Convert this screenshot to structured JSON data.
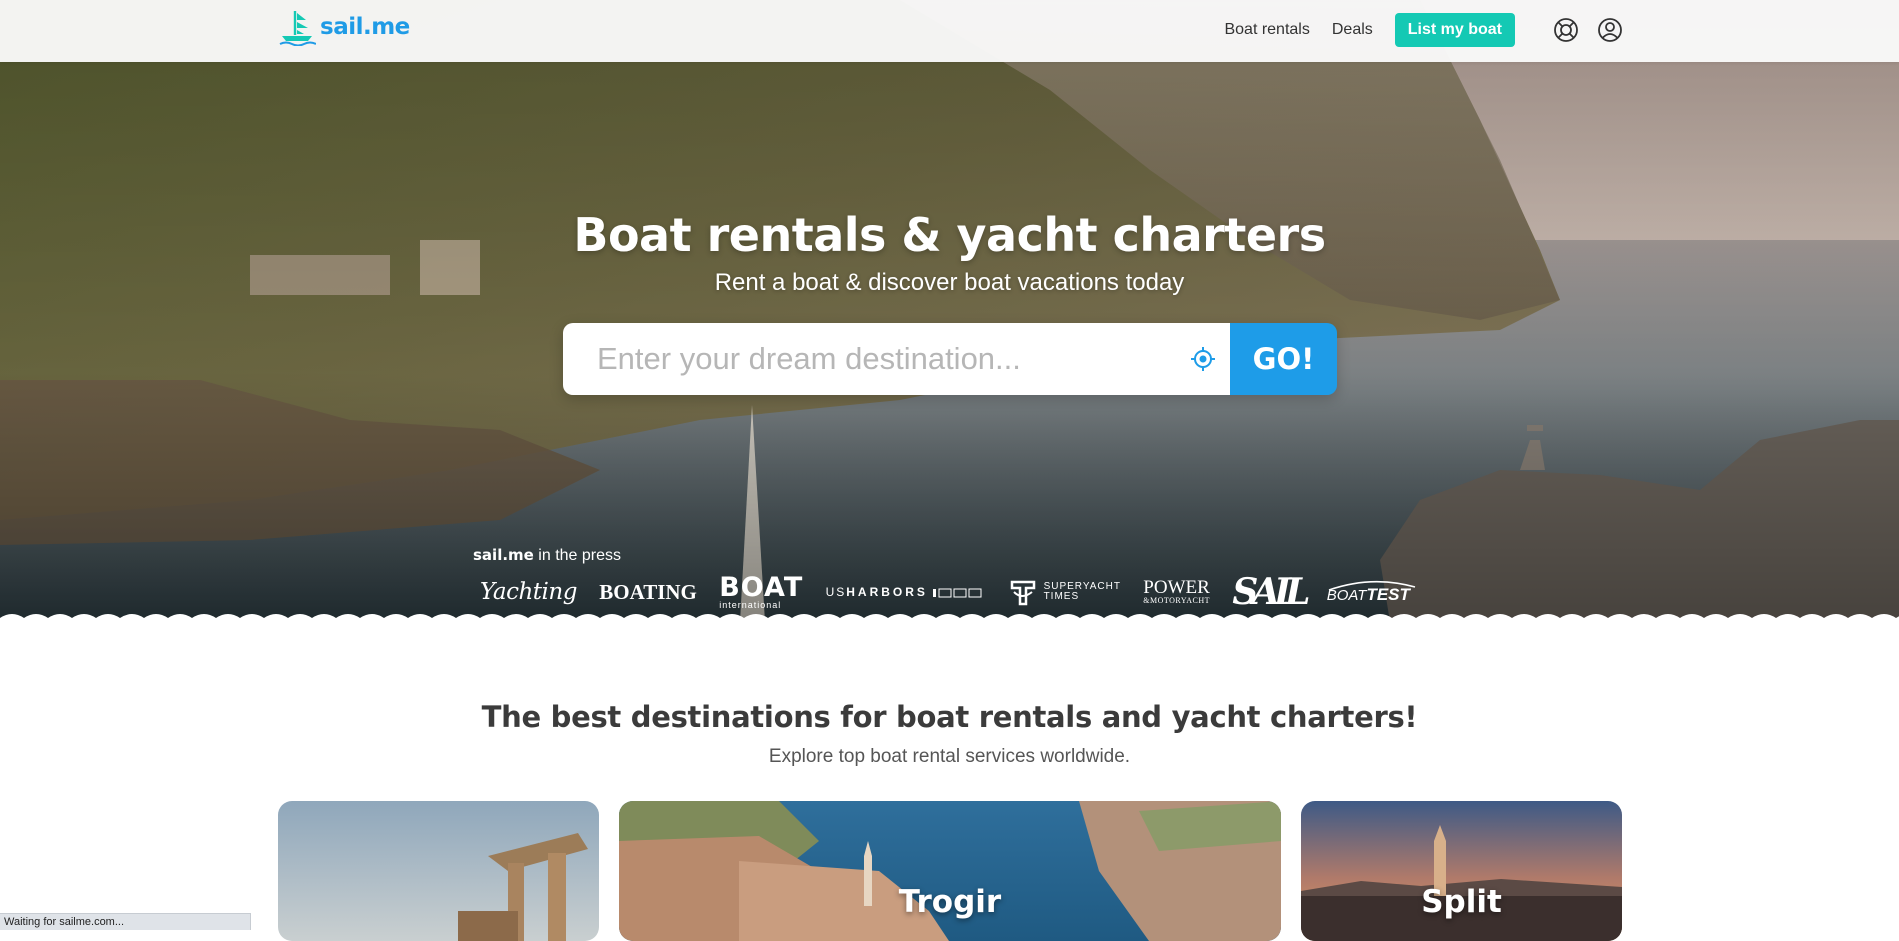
{
  "header": {
    "logo_text": "sail.me",
    "nav": {
      "boat_rentals": "Boat rentals",
      "deals": "Deals",
      "list_my_boat": "List my boat"
    },
    "icons": [
      "lifebuoy-icon",
      "user-icon"
    ]
  },
  "hero": {
    "title": "Boat rentals & yacht charters",
    "subtitle": "Rent a boat & discover boat vacations today",
    "search": {
      "placeholder": "Enter your dream destination...",
      "value": "",
      "button": "GO!"
    },
    "press": {
      "brand": "sail.me",
      "label": " in the press",
      "logos": {
        "yachting": "Yachting",
        "boating": "BOATING",
        "boat_big": "BOAT",
        "boat_small": "international",
        "usharbors_us": "US",
        "usharbors_name": "HARBORS",
        "superyacht": "SUPERYACHT",
        "times": "TIMES",
        "power": "POWER",
        "power_small": "&MOTORYACHT",
        "sail": "SAIL",
        "boattest_boat": "BOAT",
        "boattest_test": "TEST"
      }
    }
  },
  "destinations": {
    "title": "The best destinations for boat rentals and yacht charters!",
    "subtitle": "Explore top boat rental services worldwide.",
    "cards": [
      {
        "name": ""
      },
      {
        "name": "Trogir"
      },
      {
        "name": "Split"
      }
    ]
  },
  "status_bar": "Waiting for sailme.com...",
  "colors": {
    "brand_blue": "#1f9be6",
    "cta_teal": "#14c9b4",
    "go_blue": "#1e9ce8"
  }
}
